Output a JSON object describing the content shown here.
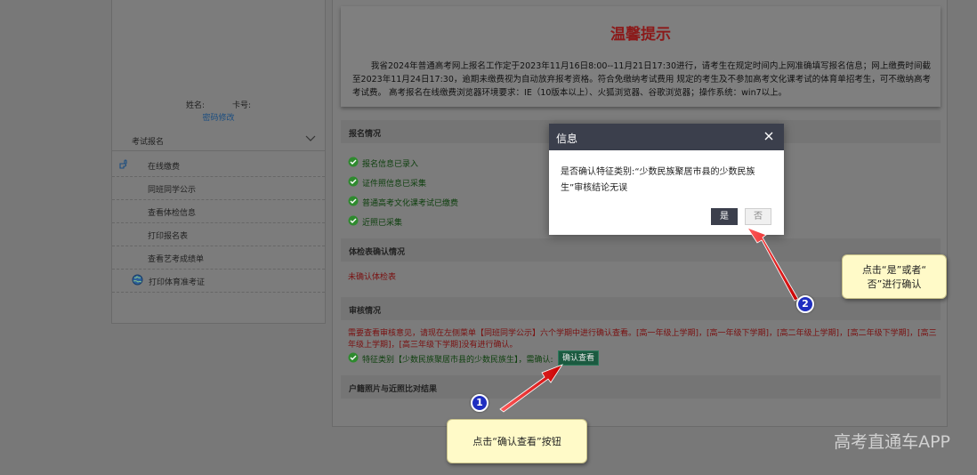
{
  "sidebar": {
    "name_label": "姓名:",
    "card_label": "卡号:",
    "password_link": "密码修改",
    "menu_header": "考试报名",
    "items": [
      {
        "label": "在线缴费",
        "icon": "hand-pointer-icon"
      },
      {
        "label": "同班同学公示"
      },
      {
        "label": "查看体检信息"
      },
      {
        "label": "打印报名表"
      },
      {
        "label": "查看艺考成绩单"
      },
      {
        "label": "打印体育准考证",
        "icon": "globe-icon"
      }
    ]
  },
  "notice": {
    "title": "温馨提示",
    "body": "我省2024年普通高考网上报名工作定于2023年11月16日8:00--11月21日17:30进行，请考生在规定时间内上网准确填写报名信息；网上缴费时间截至2023年11月24日17:30，逾期未缴费视为自动放弃报考资格。符合免缴纳考试费用 规定的考生及不参加高考文化课考试的体育单招考生，可不缴纳高考考试费。 高考报名在线缴费浏览器环境要求：IE（10版本以上）、火狐浏览器、谷歌浏览器；操作系统：win7以上。"
  },
  "sections": {
    "registration": {
      "title": "报名情况",
      "items": [
        "报名信息已录入",
        "证件照信息已采集",
        "普通高考文化课考试已缴费",
        "近照已采集"
      ]
    },
    "physical": {
      "title": "体检表确认情况",
      "status": "未确认体检表"
    },
    "review": {
      "title": "审核情况",
      "text": "需要查看审核意见，请现在左侧菜单【同班同学公示】六个学期中进行确认查看。[高一年级上学期]，[高一年级下学期]，[高二年级上学期]，[高二年级下学期]，[高三年级上学期]，[高三年级下学期]没有进行确认。",
      "item": "特征类别【少数民族聚居市县的少数民族生】，需确认:",
      "confirm_button": "确认查看"
    },
    "photo": {
      "title": "户籍照片与近照比对结果"
    }
  },
  "dialog": {
    "title": "信息",
    "message": "是否确认特征类别:“少数民族聚居市县的少数民族生”审核结论无误",
    "yes": "是",
    "no": "否"
  },
  "annotations": {
    "step1_number": "1",
    "step1_text": "点击“确认查看”按钮",
    "step2_number": "2",
    "step2_line1": "点击“是”或者“",
    "step2_line2": "否”进行确认"
  },
  "watermark": "高考直通车APP",
  "colors": {
    "overlay_bg": "#787878",
    "dialog_bar": "#3b3f4c",
    "notice_title": "#8b1a1a",
    "ok_green": "#2f8a2f",
    "confirm_button": "#1b5a40",
    "callout_bg": "#fffac8",
    "arrow_red": "#e01515",
    "step_badge": "#1f2ec0"
  }
}
